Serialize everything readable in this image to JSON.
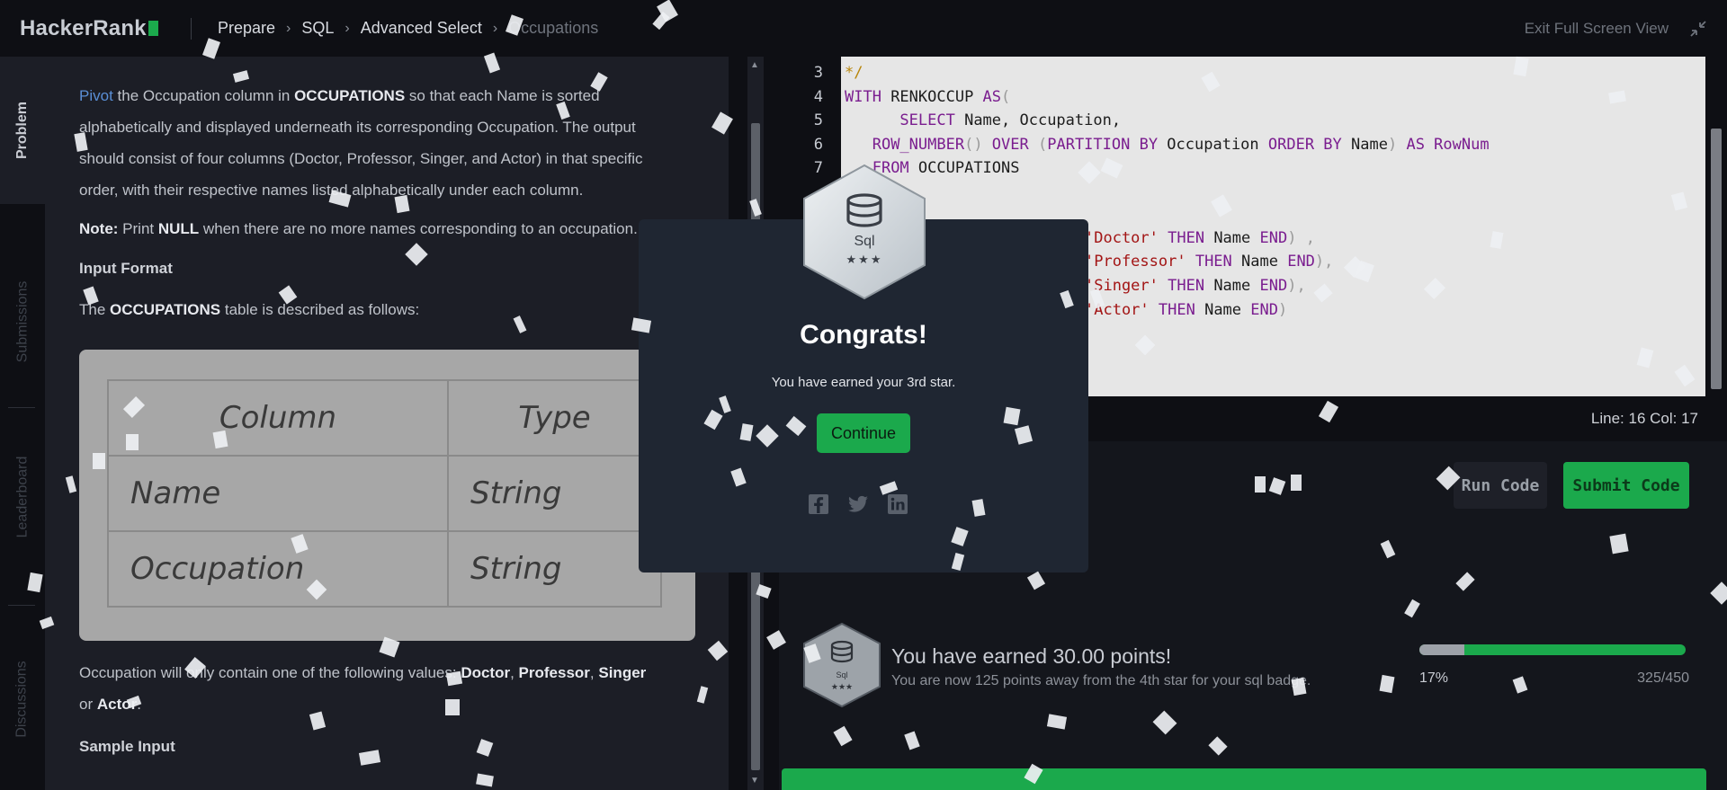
{
  "header": {
    "logo_text": "HackerRank",
    "breadcrumbs": [
      "Prepare",
      "SQL",
      "Advanced Select",
      "Occupations"
    ],
    "exit_label": "Exit Full Screen View"
  },
  "side_tabs": [
    "Problem",
    "Submissions",
    "Leaderboard",
    "Discussions"
  ],
  "problem": {
    "p1_link": "Pivot",
    "p1_rest_a": " the Occupation column in ",
    "p1_bold": "OCCUPATIONS",
    "p1_rest_b": " so that each Name is sorted alphabetically and displayed underneath its corresponding Occupation. The output should consist of four columns (Doctor, Professor, Singer, and Actor) in that specific order, with their respective names listed alphabetically under each column.",
    "note_label": "Note:",
    "note_a": " Print ",
    "note_null": "NULL",
    "note_b": " when there are no more names corresponding to an occupation.",
    "input_format_heading": "Input Format",
    "table_intro_a": "The ",
    "table_intro_bold": "OCCUPATIONS",
    "table_intro_b": " table is described as follows:",
    "table": {
      "headers": [
        "Column",
        "Type"
      ],
      "rows": [
        [
          "Name",
          "String"
        ],
        [
          "Occupation",
          "String"
        ]
      ]
    },
    "values_a": "Occupation will only contain one of the following values: ",
    "values_list": [
      "Doctor",
      "Professor",
      "Singer",
      "Actor"
    ],
    "values_sep": ", ",
    "values_or": " or ",
    "values_end": ".",
    "sample_input_heading": "Sample Input"
  },
  "editor": {
    "line_numbers": [
      "3",
      "4",
      "5",
      "6",
      "7"
    ],
    "code": {
      "l3": "*/",
      "l4_kw": "WITH",
      "l4_text": " RENKOCCUP ",
      "l4_kw2": "AS",
      "l4_paren": "(",
      "l5_indent": "      ",
      "l5_kw": "SELECT",
      "l5_text": " Name, Occupation,",
      "l6_indent": "   ",
      "l6_kw": "ROW_NUMBER",
      "l6_paren": "() ",
      "l6_kw2": "OVER",
      "l6_paren2": " (",
      "l6_kw3": "PARTITION BY",
      "l6_text": " Occupation ",
      "l6_kw4": "ORDER BY",
      "l6_text2": " Name",
      "l6_paren3": ") ",
      "l6_kw5": "AS",
      "l6_text3": " RowNum",
      "l7_indent": "   ",
      "l7_kw": "FROM",
      "l7_text": " OCCUPATIONS",
      "case_lines": [
        {
          "str": "'Doctor'",
          "then": " THEN",
          "name": " Name ",
          "end": "END",
          "tail": ") ,"
        },
        {
          "str": "'Professor'",
          "then": " THEN",
          "name": " Name ",
          "end": "END",
          "tail": "),"
        },
        {
          "str": "'Singer'",
          "then": " THEN",
          "name": " Name ",
          "end": "END",
          "tail": "),"
        },
        {
          "str": "'Actor'",
          "then": " THEN",
          "name": " Name ",
          "end": "END",
          "tail": ")"
        }
      ]
    },
    "line_col": "Line: 16 Col: 17"
  },
  "actions": {
    "run_label": "Run Code",
    "submit_label": "Submit Code"
  },
  "result": {
    "badge_name": "Sql",
    "badge_stars": "★★★",
    "title": "You have earned 30.00 points!",
    "subtitle": "You are now 125 points away from the 4th star for your sql badge.",
    "progress_percent": 17,
    "progress_label": "17%",
    "progress_count": "325/450"
  },
  "modal": {
    "badge_name": "Sql",
    "badge_stars": "★★★",
    "title": "Congrats!",
    "message": "You have earned your 3rd star.",
    "continue_label": "Continue"
  },
  "colors": {
    "accent_green": "#1ba94c",
    "background": "#0e0f14",
    "panel": "#1c1e26",
    "modal": "#1f2632"
  },
  "icons": [
    "chevron-right-icon",
    "collapse-icon",
    "database-icon",
    "facebook-icon",
    "twitter-icon",
    "linkedin-icon"
  ]
}
